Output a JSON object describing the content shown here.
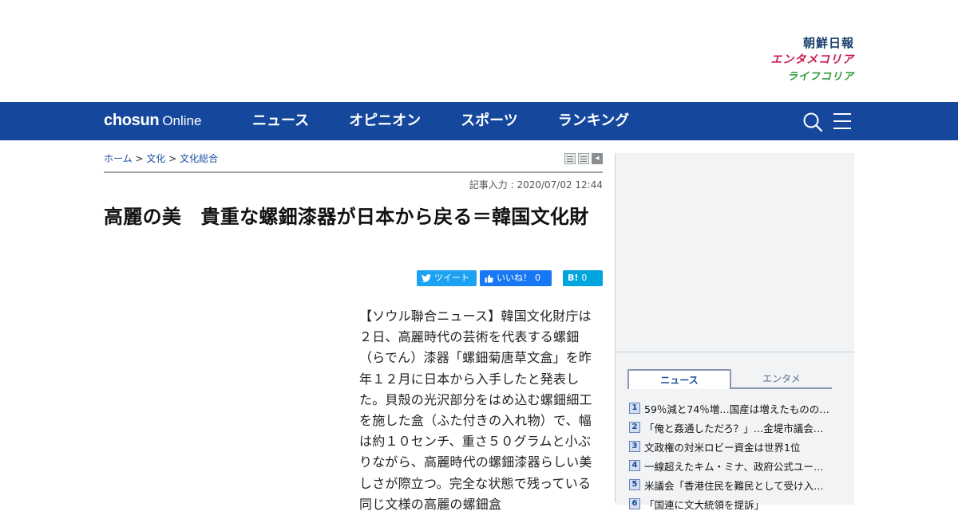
{
  "brands": {
    "chosun": "朝鮮日報",
    "enta": "エンタメコリア",
    "life": "ライフコリア"
  },
  "nav": {
    "logo_bold": "chosun",
    "logo_light": "Online",
    "items": [
      "ニュース",
      "オピニオン",
      "スポーツ",
      "ランキング"
    ]
  },
  "breadcrumb": {
    "home": "ホーム",
    "sep": ">",
    "culture": "文化",
    "general": "文化総合"
  },
  "article": {
    "date": "記事入力 : 2020/07/02 12:44",
    "title": "高麗の美　貴重な螺鈿漆器が日本から戻る＝韓国文化財",
    "body": "【ソウル聯合ニュース】韓国文化財庁は２日、高麗時代の芸術を代表する螺鈿（らでん）漆器「螺鈿菊唐草文盒」を昨年１２月に日本から入手したと発表した。貝殻の光沢部分をはめ込む螺鈿細工を施した盒（ふた付きの入れ物）で、幅は約１０センチ、重さ５０グラムと小ぶりながら、高麗時代の螺鈿漆器らしい美しさが際立つ。完全な状態で残っている同じ文様の高麗の螺鈿盒"
  },
  "share": {
    "tweet": "ツイート",
    "like": "いいね！",
    "like_count": "0",
    "hatena": "B!",
    "hatena_count": "0"
  },
  "ranking": {
    "tab_news": "ニュース",
    "tab_enta": "エンタメ",
    "items": [
      {
        "num": "1",
        "text": "59％減と74％増…国産は増えたものの…"
      },
      {
        "num": "2",
        "text": "「俺と姦通しただろ？」…金堤市議会…"
      },
      {
        "num": "3",
        "text": "文政権の対米ロビー資金は世界1位"
      },
      {
        "num": "4",
        "text": "一線超えたキム・ミナ、政府公式ユー…"
      },
      {
        "num": "5",
        "text": "米議会「香港住民を難民として受け入…"
      },
      {
        "num": "6",
        "text": "「国連に文大統領を提訴」"
      }
    ]
  },
  "colors": {
    "nav_bg": "#15489c",
    "link": "#1a4da0",
    "brand_chosun": "#1b3f6e",
    "brand_enta": "#c8174b",
    "brand_life": "#2d9a3a"
  }
}
